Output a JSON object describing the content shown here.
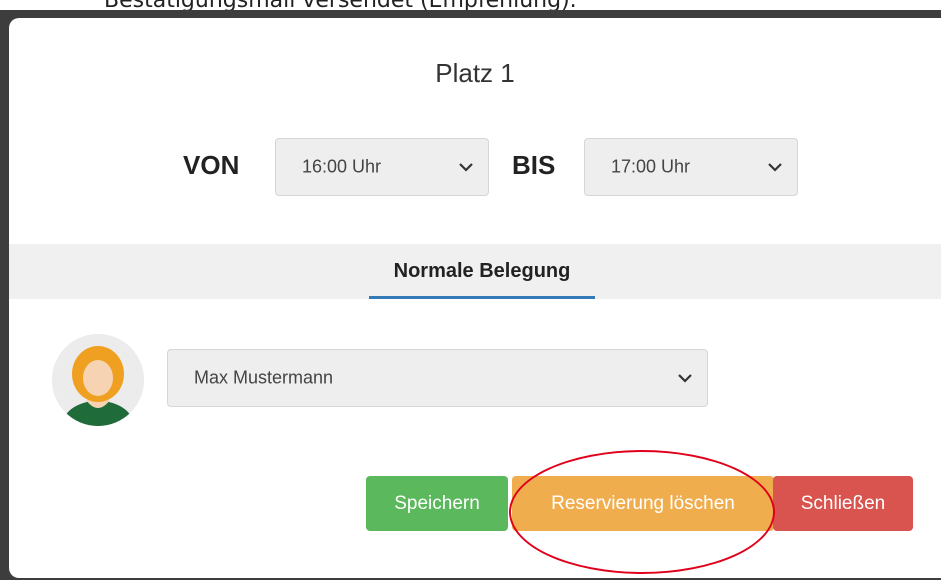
{
  "caption": "Bestätigungsmail versendet (Empfehlung).",
  "modal": {
    "title": "Platz 1",
    "from_label": "VON",
    "from_value": "16:00 Uhr",
    "to_label": "BIS",
    "to_value": "17:00 Uhr",
    "tab_label": "Normale Belegung",
    "member_value": "Max Mustermann",
    "buttons": {
      "save": "Speichern",
      "delete": "Reservierung löschen",
      "close": "Schließen"
    }
  },
  "icons": {
    "dropdown": "chevron-down-icon",
    "avatar": "user-avatar-icon"
  },
  "colors": {
    "save": "#5cb85c",
    "delete": "#f0ad4e",
    "close": "#d9534f",
    "tab_accent": "#337ab7",
    "highlight": "#e0001b"
  }
}
